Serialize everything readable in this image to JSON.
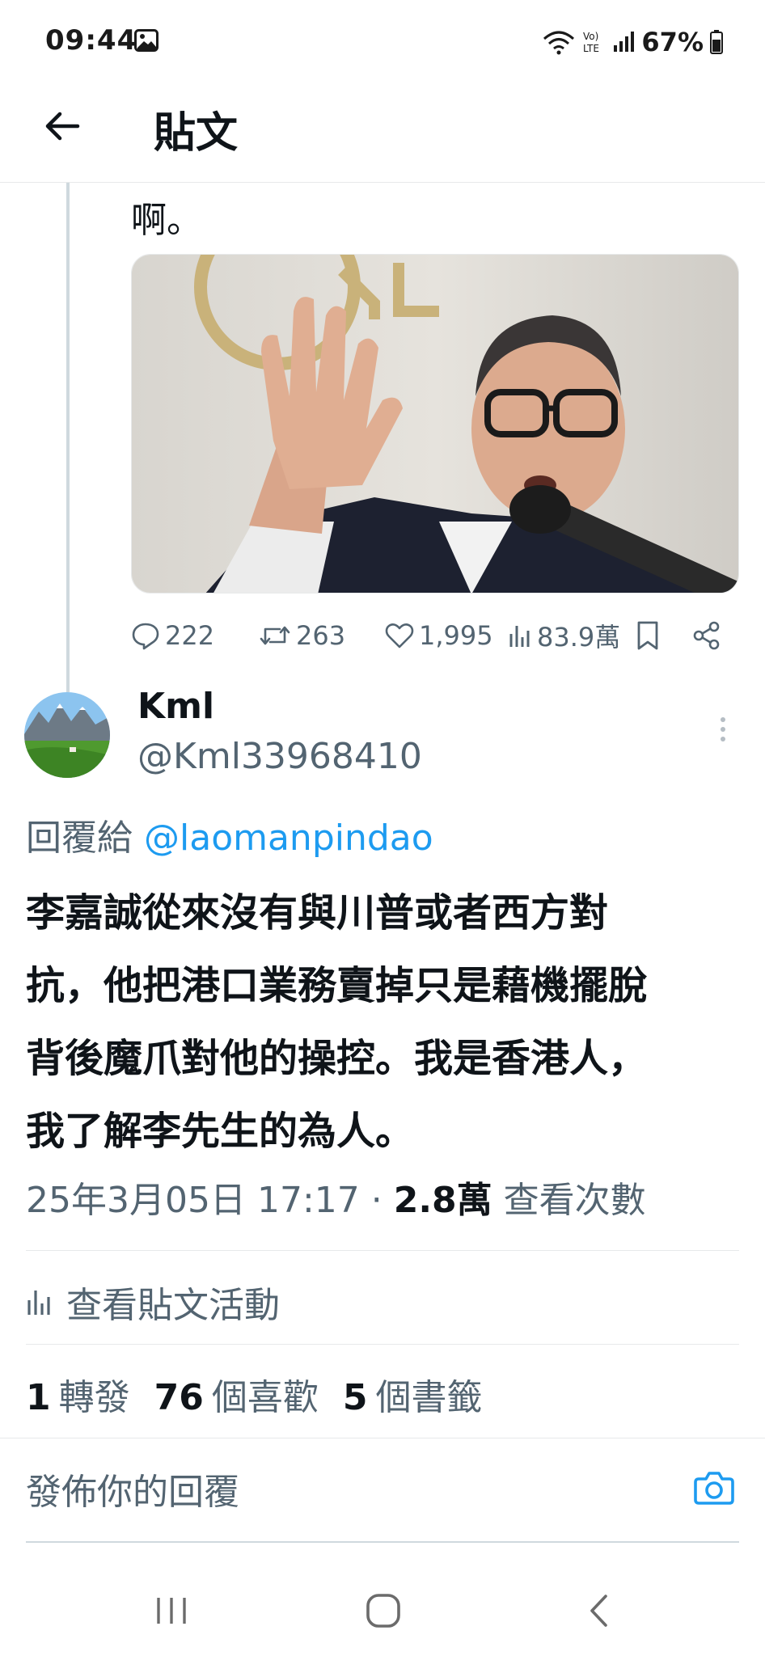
{
  "status_bar": {
    "time": "09:44",
    "battery": "67%",
    "icons": [
      "gallery-icon",
      "wifi-icon",
      "volte-icon",
      "signal-icon",
      "battery-icon"
    ]
  },
  "header": {
    "title": "貼文",
    "back_icon": "arrow-left-icon"
  },
  "quoted_post": {
    "text_tail": "啊。",
    "actions": {
      "replies": "222",
      "reposts": "263",
      "likes": "1,995",
      "views": "83.9萬"
    }
  },
  "reply": {
    "author_name": "Kml",
    "author_handle": "@Kml33968410",
    "reply_to_label": "回覆給",
    "reply_to_handle": "@laomanpindao",
    "body_lines": [
      "李嘉誠從來沒有與川普或者西方對",
      "抗，他把港口業務賣掉只是藉機擺脫",
      "背後魔爪對他的操控。我是香港人，",
      "我了解李先生的為人。"
    ],
    "timestamp": "25年3月05日 17:17 · ",
    "view_count": "2.8萬",
    "view_label": " 查看次數",
    "activity_label": "查看貼文活動",
    "stats": {
      "reposts_num": "1",
      "reposts_label": "轉發",
      "likes_num": "76",
      "likes_label": "個喜歡",
      "bookmarks_num": "5",
      "bookmarks_label": "個書籤"
    }
  },
  "compose": {
    "placeholder": "發佈你的回覆"
  },
  "colors": {
    "accent": "#1d9bf0",
    "secondary_text": "#536471",
    "primary_text": "#0f1419",
    "divider": "#e7e9ea"
  }
}
